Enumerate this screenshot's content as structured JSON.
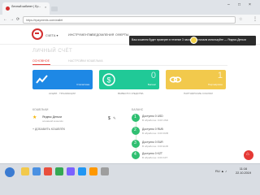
{
  "browser": {
    "tab_label": "Личный кабинет | Ep...",
    "tab_close": "×",
    "url": "https://epayments.com/wallet",
    "window_controls": [
      "–",
      "□",
      "×"
    ],
    "nav": [
      "←",
      "→",
      "⟳"
    ],
    "star": "☆",
    "menu": "⋮"
  },
  "header": {
    "nav_items": [
      "СЧЕТА ▾",
      "ИНСТРУМЕНТЫ",
      "УВЕДОМЛЕНИЯ",
      "ОФЕРТЫ"
    ]
  },
  "notification": {
    "text": "Ваш кошелек будет проверен в течение 3 часов. Для начала используйте — Яндекс.Деньги"
  },
  "page": {
    "title": "ЛИЧНЫЙ СЧЁТ",
    "tabs": [
      "ОСНОВНОЕ",
      "НАСТРОЙКИ КОШЕЛЬКА"
    ]
  },
  "cards": [
    {
      "value": "",
      "sub": "Статистика",
      "caption": "АКЦИИ · ТРАНЗАКЦИИ",
      "color": "#1e88e5",
      "icon": "chart-icon"
    },
    {
      "value": "0",
      "sub": "Баланс",
      "caption": "ВЫВЕСТИ СРЕДСТВА",
      "color": "#20c997",
      "icon": "dollar-icon"
    },
    {
      "value": "1",
      "sub": "Партнёрские",
      "caption": "ПАРТНЁРСКИЕ ССЫЛКИ",
      "color": "#f2c94c",
      "icon": "link-icon"
    }
  ],
  "wallets": {
    "title": "КОШЕЛЬКИ",
    "name": "Яндекс Деньги",
    "desc": "основной кошелёк",
    "amount": "$",
    "edit": "✎",
    "add": "+ ДОБАВИТЬ КОШЕЛЁК"
  },
  "activity": {
    "title": "БАЛАНС",
    "items": [
      {
        "n": "1",
        "title": "Доступно 0 USD",
        "sub": "В обработке: 0.00 USD"
      },
      {
        "n": "2",
        "title": "Доступно 0 RUB",
        "sub": "В обработке: 0.00 RUB"
      },
      {
        "n": "3",
        "title": "Доступно 0 EUR",
        "sub": "В обработке: 0.00 EUR"
      },
      {
        "n": "4",
        "title": "Доступно 0 KZT",
        "sub": "В обработке: 0.00 KZT"
      }
    ]
  },
  "fab_icon": "⌂",
  "taskbar": {
    "tray": "RU ▲ ♪",
    "time": "11:16",
    "date": "22.10.2019"
  },
  "colors": {
    "accent": "#e53935",
    "success": "#2fbf71"
  }
}
